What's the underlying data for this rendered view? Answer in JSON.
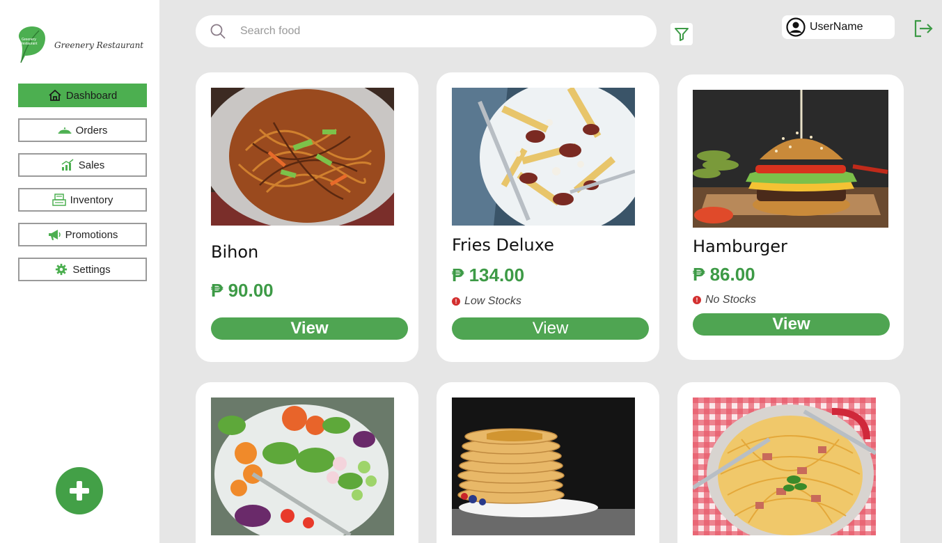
{
  "brand": {
    "logo_text": "Greenery Restaurant",
    "leaf_text_line1": "Greenery",
    "leaf_text_line2": "Restaurant"
  },
  "sidebar": {
    "items": [
      {
        "label": "Dashboard",
        "icon": "home-icon",
        "active": true
      },
      {
        "label": "Orders",
        "icon": "cloche-icon"
      },
      {
        "label": "Sales",
        "icon": "sales-chart-icon"
      },
      {
        "label": "Inventory",
        "icon": "inventory-icon"
      },
      {
        "label": "Promotions",
        "icon": "megaphone-icon"
      },
      {
        "label": "Settings",
        "icon": "gear-icon"
      }
    ],
    "add_button_icon": "plus-icon"
  },
  "search": {
    "placeholder": "Search food",
    "value": ""
  },
  "user": {
    "name": "UserName"
  },
  "colors": {
    "accent": "#4fa552",
    "price": "#3d9a46",
    "alert": "#d32f2f",
    "background": "#e6e6e6"
  },
  "foods": [
    {
      "name": "Bihon",
      "price": "₱ 90.00",
      "stock": "",
      "action": "View"
    },
    {
      "name": "Fries Deluxe",
      "price": "₱ 134.00",
      "stock": "Low Stocks",
      "action": "View"
    },
    {
      "name": "Hamburger",
      "price": "₱ 86.00",
      "stock": "No Stocks",
      "action": "View"
    },
    {
      "name": "",
      "price": "",
      "stock": "",
      "action": ""
    },
    {
      "name": "",
      "price": "",
      "stock": "",
      "action": ""
    },
    {
      "name": "",
      "price": "",
      "stock": "",
      "action": ""
    }
  ],
  "stock_alert_symbol": "!"
}
